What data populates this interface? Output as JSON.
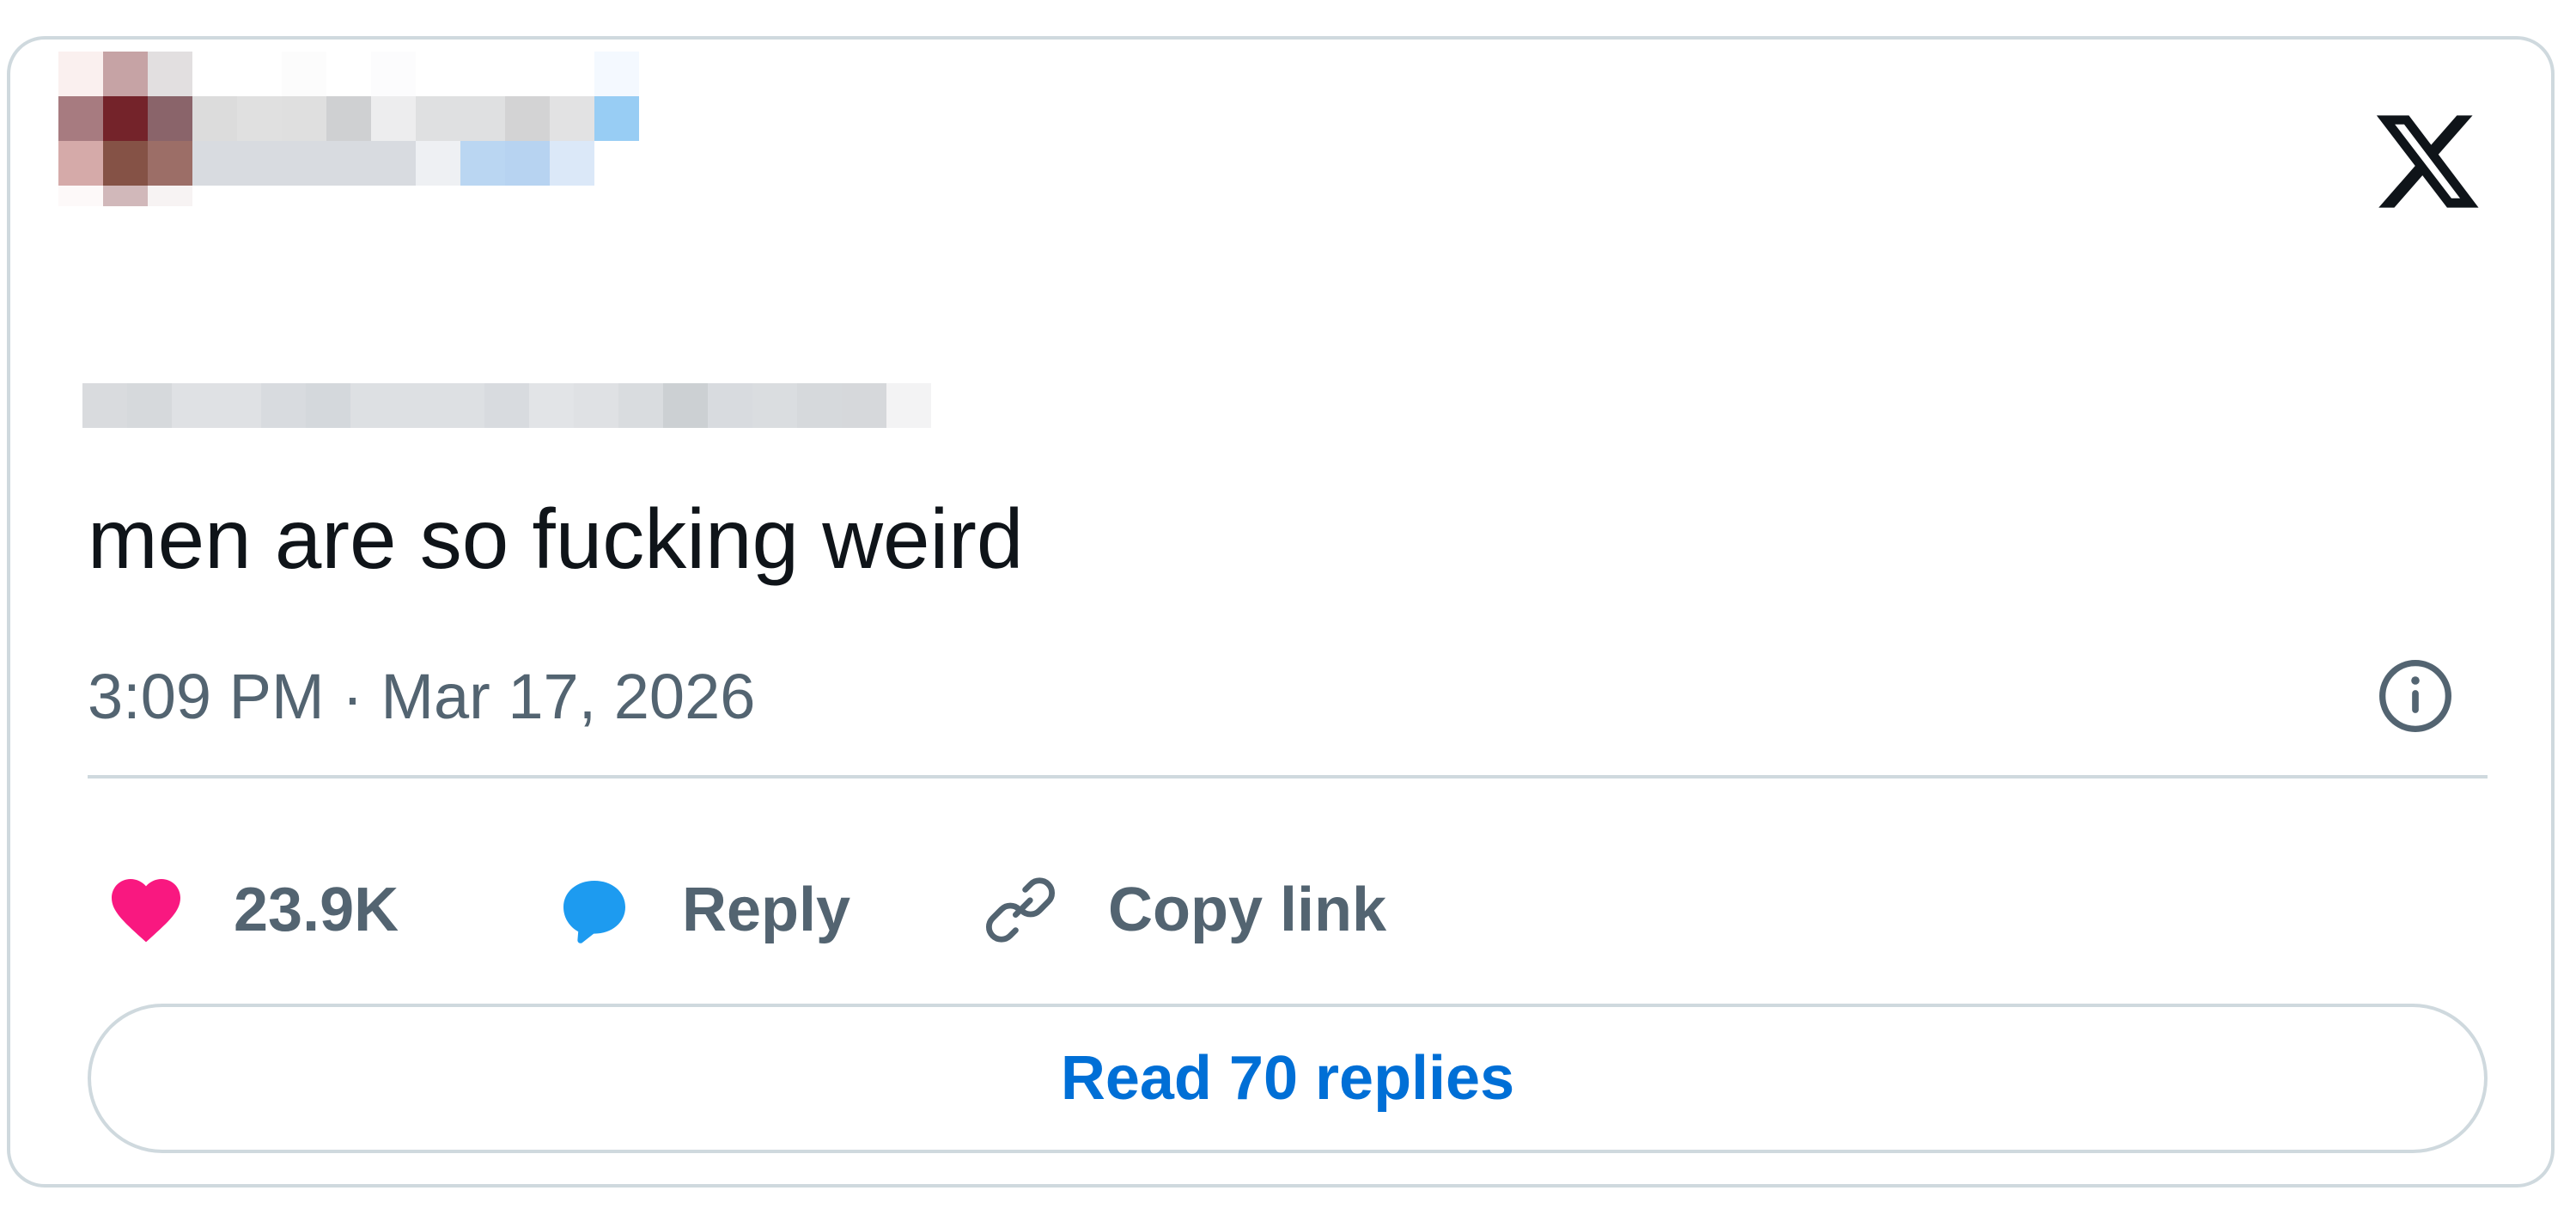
{
  "tweet": {
    "text": "men are so fucking weird",
    "timestamp": "3:09 PM · Mar 17, 2026"
  },
  "actions": {
    "likes_count": "23.9K",
    "reply_label": "Reply",
    "copy_link_label": "Copy link"
  },
  "cta": {
    "read_replies_label": "Read 70 replies"
  },
  "icons": {
    "logo": "x-logo-icon",
    "info": "info-icon",
    "heart": "heart-icon",
    "reply": "speech-bubble-icon",
    "link": "link-icon"
  },
  "colors": {
    "text_primary": "#0f1419",
    "text_secondary": "#536471",
    "border": "#cfd9de",
    "accent_blue": "#006fd6",
    "heart_pink": "#f91880",
    "reply_blue": "#1d9bf0"
  }
}
